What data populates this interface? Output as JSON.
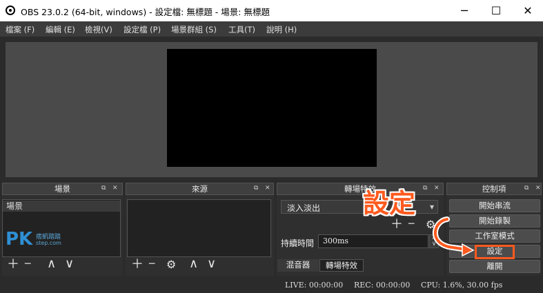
{
  "window": {
    "title": "OBS 23.0.2 (64-bit, windows) - 設定檔: 無標題 - 場景: 無標題",
    "minimize": "─",
    "maximize": "☐",
    "close": "✕"
  },
  "menu": [
    "檔案 (F)",
    "編輯 (E)",
    "檢視(V)",
    "設定檔 (P)",
    "場景群組 (S)",
    "工具(T)",
    "說明 (H)"
  ],
  "docks": {
    "scenes": {
      "title": "場景",
      "items": [
        "場景"
      ]
    },
    "sources": {
      "title": "來源"
    },
    "transitions": {
      "title": "轉場特效",
      "selected": "淡入淡出",
      "duration_label": "持續時間",
      "duration_value": "300ms"
    },
    "controls": {
      "title": "控制項",
      "buttons": [
        "開始串流",
        "開始錄製",
        "工作室模式",
        "設定",
        "離開"
      ]
    }
  },
  "tabs": [
    "混音器",
    "轉場特效"
  ],
  "status": {
    "live": "LIVE: 00:00:00",
    "rec": "REC: 00:00:00",
    "cpu": "CPU: 1.6%, 30.00 fps"
  },
  "annotation": {
    "label": "設定",
    "color": "#ff5a1f"
  },
  "watermark": {
    "logo": "PK",
    "text": "痞凱踏踏",
    "sub": "step.com"
  },
  "icons": {
    "float": "⧉",
    "close": "✕",
    "add": "＋",
    "remove": "─",
    "gear": "⚙",
    "up": "∧",
    "down": "∨",
    "dropdown": "▾"
  }
}
